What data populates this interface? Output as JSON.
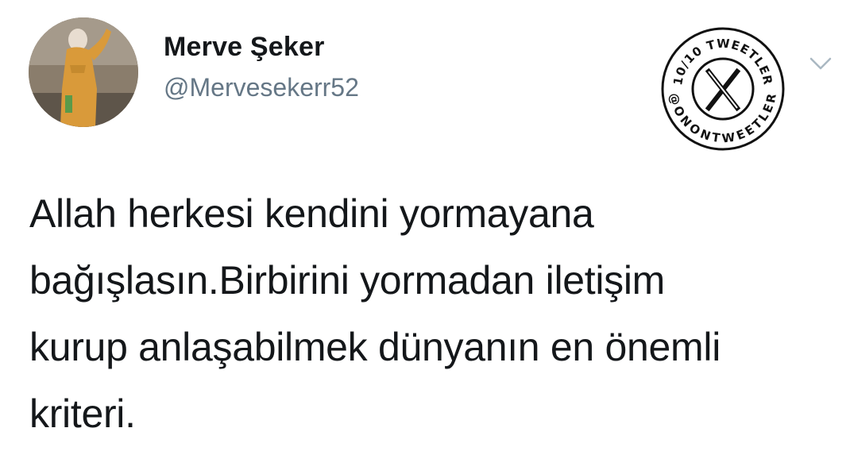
{
  "author": {
    "display_name": "Merve Şeker",
    "handle": "@Mervesekerr52"
  },
  "watermark": {
    "top_text": "10/10 TWEETLER",
    "bottom_text": "@ONONTWEETLER",
    "center": "X"
  },
  "tweet": {
    "lines": [
      "Allah herkesi kendini yormayana",
      "bağışlasın.Birbirini yormadan iletişim",
      "kurup anlaşabilmek dünyanın en önemli",
      "kriteri."
    ]
  },
  "icons": {
    "menu": "chevron-down-icon",
    "watermark": "x-logo-icon"
  },
  "colors": {
    "text": "#14171a",
    "handle": "#657786",
    "chevron": "#aab8c2"
  }
}
